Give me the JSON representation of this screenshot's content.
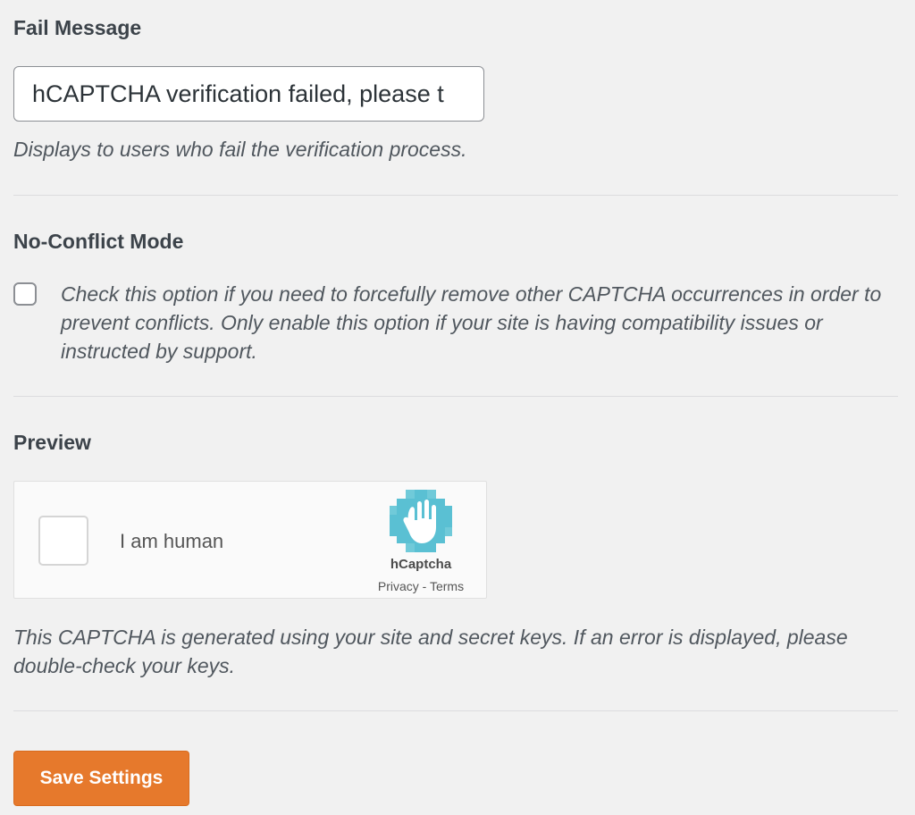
{
  "fail_message": {
    "heading": "Fail Message",
    "input_value": "hCAPTCHA verification failed, please t",
    "description": "Displays to users who fail the verification process."
  },
  "no_conflict": {
    "heading": "No-Conflict Mode",
    "checked": false,
    "description": "Check this option if you need to forcefully remove other CAPTCHA occurrences in order to prevent conflicts. Only enable this option if your site is having compatibility issues or instructed by support."
  },
  "preview": {
    "heading": "Preview",
    "widget": {
      "label": "I am human",
      "brand": "hCaptcha",
      "privacy_link": "Privacy",
      "separator": " - ",
      "terms_link": "Terms"
    },
    "description": "This CAPTCHA is generated using your site and secret keys. If an error is displayed, please double-check your keys."
  },
  "save_button_label": "Save Settings",
  "colors": {
    "accent_button": "#e6792c",
    "hcaptcha_logo": "#5ac0d3",
    "background": "#f1f1f1"
  },
  "icons": {
    "captcha_logo": "hcaptcha-hand-logo-icon"
  }
}
